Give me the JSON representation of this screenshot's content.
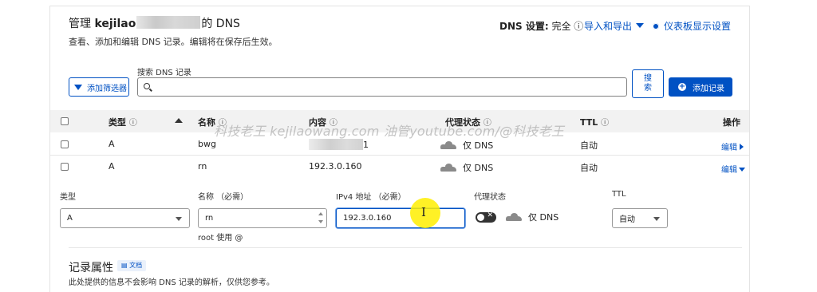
{
  "header": {
    "title_prefix": "管理 ",
    "title_domain": "kejilao",
    "title_suffix": "的 DNS",
    "subtitle": "查看、添加和编辑 DNS 记录。编辑将在保存后生效。",
    "dns_setting_label": "DNS 设置:",
    "dns_setting_value": "完全 ⓘ",
    "import_export": "导入和导出",
    "dashboard_settings": "仪表板显示设置"
  },
  "toolbar": {
    "filter_button": "添加筛选器",
    "search_label": "搜索 DNS 记录",
    "search_placeholder": "",
    "search_button": "搜\n索",
    "add_record_button": "添加记录"
  },
  "table": {
    "columns": {
      "type": "类型",
      "name": "名称",
      "content": "内容",
      "proxy": "代理状态",
      "ttl": "TTL",
      "actions": "操作"
    },
    "info_glyph": "ⓘ",
    "rows": [
      {
        "type": "A",
        "name": "bwg",
        "content": "",
        "content_suffix": "1",
        "proxy": "仅 DNS",
        "ttl": "自动",
        "action": "编辑"
      },
      {
        "type": "A",
        "name": "rn",
        "content": "192.3.0.160",
        "content_suffix": "",
        "proxy": "仅 DNS",
        "ttl": "自动",
        "action": "编辑"
      }
    ]
  },
  "watermark": "科技老王 kejilaowang.com 油管youtube.com/@科技老王",
  "edit_form": {
    "type_label": "类型",
    "type_value": "A",
    "name_label": "名称 （必需）",
    "name_value": "rn",
    "name_hint": "root 使用 @",
    "ipv4_label": "IPv4 地址 （必需）",
    "ipv4_value": "192.3.0.160",
    "proxy_label": "代理状态",
    "proxy_value": "仅 DNS",
    "proxy_enabled": false,
    "ttl_label": "TTL",
    "ttl_value": "自动"
  },
  "record_attributes": {
    "title": "记录属性",
    "doc_badge": "文档",
    "description": "此处提供的信息不会影响 DNS 记录的解析，仅供您参考。"
  },
  "colors": {
    "accent": "#0051c3",
    "header_bg": "#f2f2f2",
    "cursor_highlight": "#ffee00"
  }
}
